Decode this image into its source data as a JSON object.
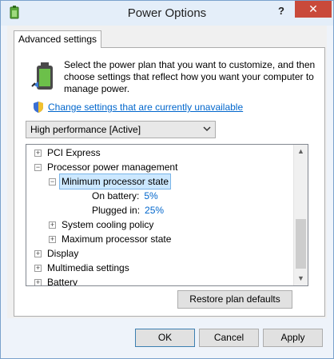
{
  "window": {
    "title": "Power Options",
    "help_label": "?",
    "close_label": "✕"
  },
  "tab": {
    "label": "Advanced settings"
  },
  "description": "Select the power plan that you want to customize, and then choose settings that reflect how you want your computer to manage power.",
  "change_link": "Change settings that are currently unavailable",
  "plan_select": {
    "value": "High performance [Active]"
  },
  "tree": {
    "items": [
      {
        "label": "PCI Express",
        "expander": "+"
      },
      {
        "label": "Processor power management",
        "expander": "−"
      },
      {
        "label": "Minimum processor state",
        "expander": "−"
      },
      {
        "label": "On battery:",
        "value": "5%"
      },
      {
        "label": "Plugged in:",
        "value": "25%"
      },
      {
        "label": "System cooling policy",
        "expander": "+"
      },
      {
        "label": "Maximum processor state",
        "expander": "+"
      },
      {
        "label": "Display",
        "expander": "+"
      },
      {
        "label": "Multimedia settings",
        "expander": "+"
      },
      {
        "label": "Battery",
        "expander": "+"
      }
    ]
  },
  "restore_button": "Restore plan defaults",
  "buttons": {
    "ok": "OK",
    "cancel": "Cancel",
    "apply": "Apply"
  },
  "colors": {
    "link": "#0066cc",
    "selection": "#cce8ff",
    "close": "#c94a3a"
  }
}
